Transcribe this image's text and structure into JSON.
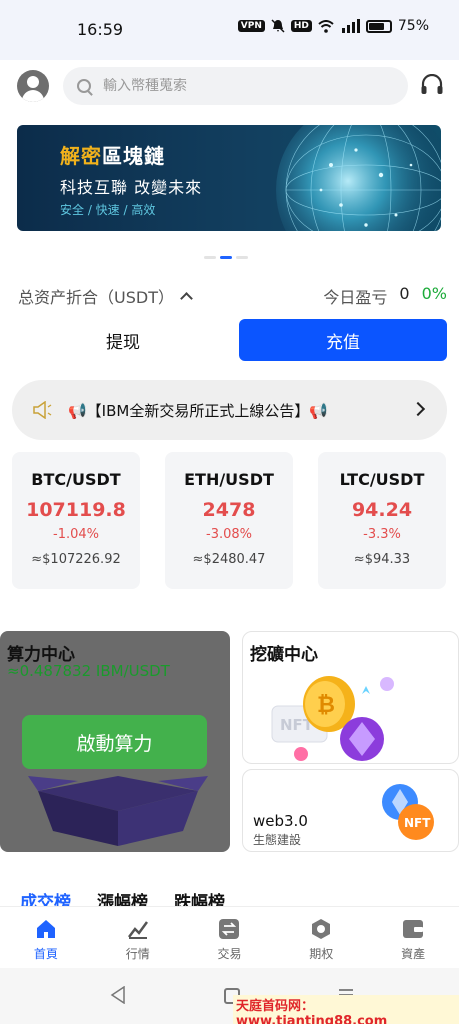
{
  "status_bar": {
    "time": "16:59",
    "vpn": "VPN",
    "hd": "HD",
    "battery": "75%"
  },
  "header": {
    "search_placeholder": "輸入幣種蒐索"
  },
  "banner": {
    "title_gold": "解密",
    "title_white": "區塊鏈",
    "subtitle": "科技互聯 改變未來",
    "tagline": "安全 / 快速 / 高效"
  },
  "assets": {
    "label": "总资产折合（USDT）",
    "pnl_label": "今日盈亏",
    "pnl_value": "0",
    "pnl_pct": "0%"
  },
  "actions": {
    "withdraw": "提现",
    "deposit": "充值"
  },
  "notice": {
    "text": "📢【IBM全新交易所正式上線公告】📢"
  },
  "tickers": [
    {
      "pair": "BTC/USDT",
      "price": "107119.8",
      "change": "-1.04%",
      "usd": "≈$107226.92"
    },
    {
      "pair": "ETH/USDT",
      "price": "2478",
      "change": "-3.08%",
      "usd": "≈$2480.47"
    },
    {
      "pair": "LTC/USDT",
      "price": "94.24",
      "change": "-3.3%",
      "usd": "≈$94.33"
    }
  ],
  "compute_card": {
    "title": "算力中心",
    "value": "≈0.487832 IBM/USDT",
    "button": "啟動算力"
  },
  "mining_card": {
    "title": "挖礦中心",
    "badge": "NFT"
  },
  "web3_card": {
    "title": "web3.0",
    "subtitle": "生態建設",
    "badge": "NFT"
  },
  "rank_tabs": [
    "成交榜",
    "漲幅榜",
    "跌幅榜"
  ],
  "bottom_nav": [
    {
      "label": "首頁",
      "icon": "home-icon",
      "active": true
    },
    {
      "label": "行情",
      "icon": "chart-icon",
      "active": false
    },
    {
      "label": "交易",
      "icon": "exchange-icon",
      "active": false
    },
    {
      "label": "期权",
      "icon": "options-icon",
      "active": false
    },
    {
      "label": "資產",
      "icon": "wallet-icon",
      "active": false
    }
  ],
  "watermark": "天庭首码网：www.tianting88.com",
  "colors": {
    "accent": "#0b55ff",
    "down": "#e34d4d",
    "up": "#1dab3a",
    "compute_button": "#43b14c"
  }
}
